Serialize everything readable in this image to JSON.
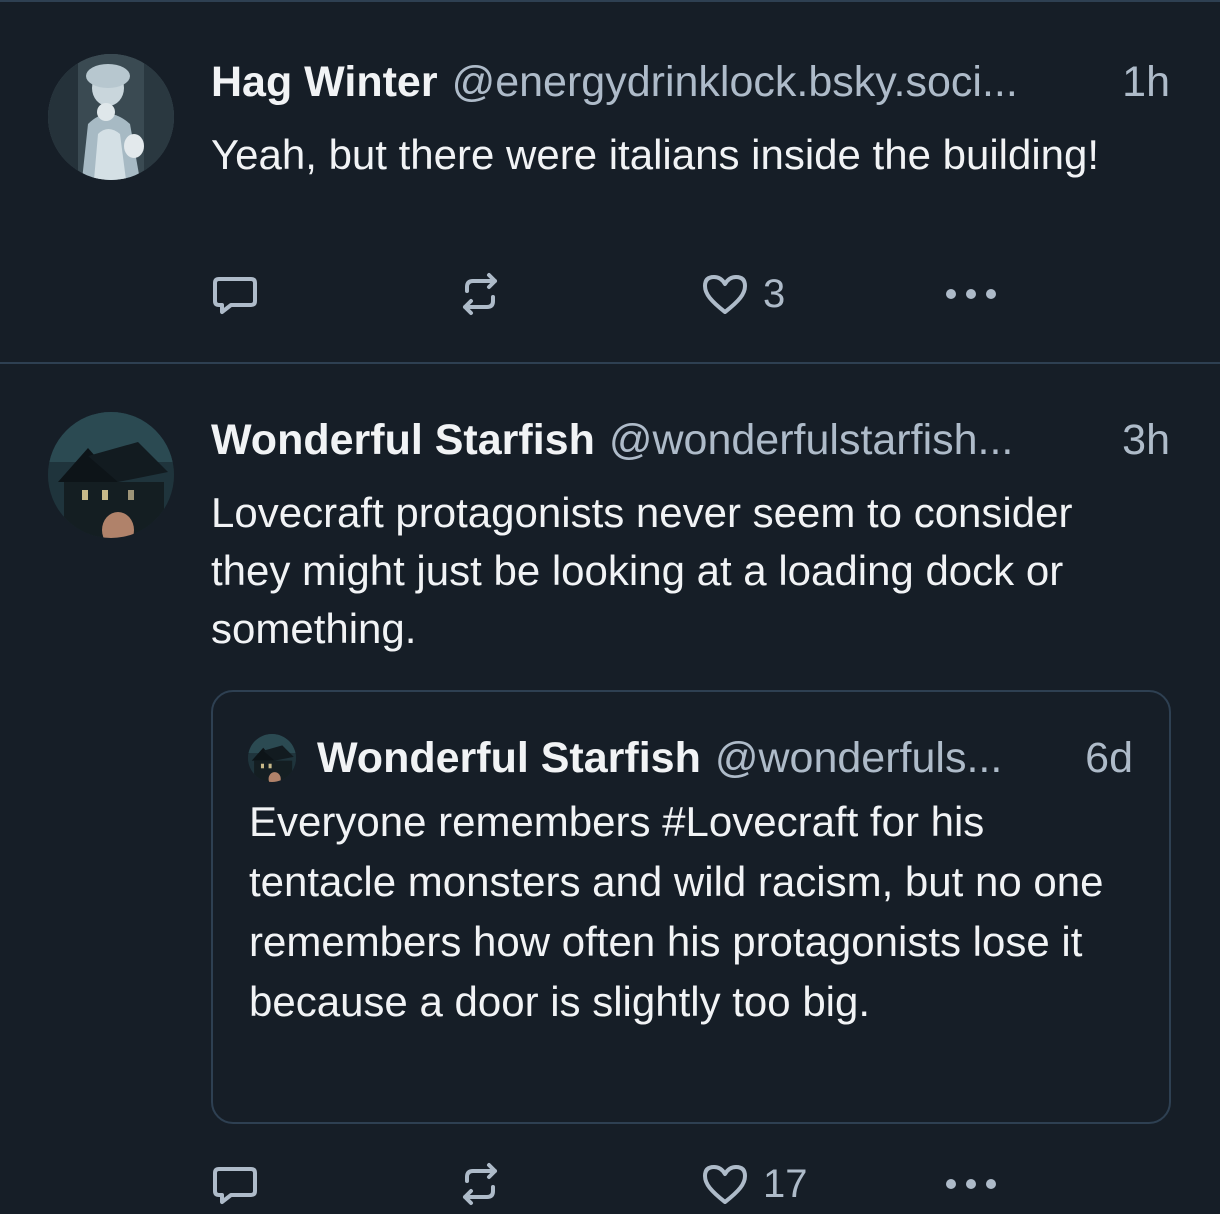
{
  "colors": {
    "background": "#161e27",
    "divider": "#2e4052",
    "text_primary": "#f1f3f5",
    "text_secondary": "#aebbc9"
  },
  "posts": [
    {
      "display_name": "Hag Winter",
      "handle": "@energydrinklock.bsky.soci...",
      "time": "1h",
      "text": "Yeah, but there were italians inside the building!",
      "avatar_icon": "avatar-victorian-figure",
      "actions": {
        "reply_icon": "reply-icon",
        "repost_icon": "repost-icon",
        "like_icon": "heart-icon",
        "like_count": "3",
        "more_icon": "more-icon"
      }
    },
    {
      "display_name": "Wonderful Starfish",
      "handle": "@wonderfulstarfish...",
      "time": "3h",
      "text": "Lovecraft protagonists never seem to consider they might just be looking at a loading dock or something.",
      "avatar_icon": "avatar-dark-house",
      "quote": {
        "display_name": "Wonderful Starfish",
        "handle": "@wonderfuls...",
        "time": "6d",
        "text": "Everyone remembers #Lovecraft for his tentacle monsters and wild racism, but no one remembers how often his protagonists lose it because a door is slightly too big."
      },
      "actions": {
        "reply_icon": "reply-icon",
        "repost_icon": "repost-icon",
        "like_icon": "heart-icon",
        "like_count": "17",
        "more_icon": "more-icon"
      }
    }
  ]
}
